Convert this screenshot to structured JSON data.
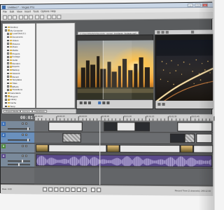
{
  "app": {
    "title": "Untitled * - Vegas Pro",
    "menus": [
      "File",
      "Edit",
      "View",
      "Insert",
      "Tools",
      "Options",
      "Help"
    ]
  },
  "explorer": {
    "items": [
      "Desktop",
      "My Computer",
      "Local Disk (C:)",
      "Documents",
      "Videos",
      "Pictures",
      "Music",
      "Media",
      "Projects",
      "Footage",
      "Audio",
      "Renders",
      "Exports",
      "Backup",
      "Network",
      "Recent",
      "Templates",
      "Titles",
      "Effects",
      "Transitions",
      "Generators",
      "Plug-ins",
      "Library",
      "Cache",
      "Temp"
    ]
  },
  "trimmer": {
    "path": "C:\\Users\\Media\\Videos\\city_sunset_timelapse_footage.mp4"
  },
  "lower_tabs": [
    "Project Media",
    "Explorer",
    "Transitions"
  ],
  "timeline": {
    "timecode": "00:01:15:21",
    "ruler_labels": [
      "00:00:00",
      "00:00:15",
      "00:00:30",
      "00:00:45",
      "00:01:00",
      "00:01:15",
      "00:01:30",
      "00:01:45",
      "00:02:00"
    ],
    "tracks": [
      {
        "num": "1",
        "color": "#3c6fb4"
      },
      {
        "num": "2",
        "color": "#3c6fb4"
      },
      {
        "num": "3",
        "color": "#4f8a3e"
      },
      {
        "num": "4",
        "color": "#5b4a8c"
      }
    ]
  },
  "status": {
    "rate": "Rate: 0.00",
    "record_time": "Record Time (2 channels): 245:12:30"
  },
  "icons": {
    "new": "new-file-icon",
    "open": "open-folder-icon",
    "save": "save-icon",
    "play": "play-icon",
    "stop": "stop-icon",
    "loop": "loop-icon"
  },
  "colors": {
    "accent": "#3c6fb4",
    "timeline_bg": "#5f6163",
    "purple_audio": "#5b4a8c"
  }
}
